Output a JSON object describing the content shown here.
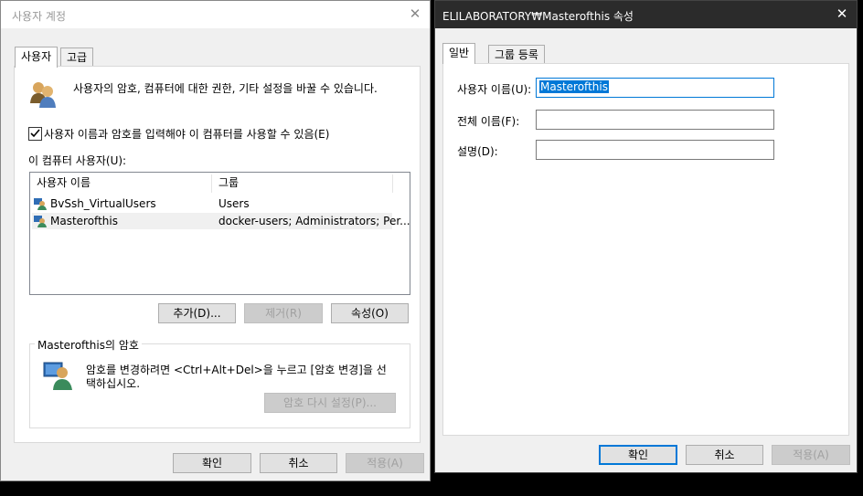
{
  "left_window": {
    "title": "사용자 계정",
    "tabs": [
      "사용자",
      "고급"
    ],
    "intro": "사용자의 암호, 컴퓨터에 대한 권한, 기타 설정을 바꿀 수 있습니다.",
    "require_login_checkbox": {
      "label": "사용자 이름과 암호를 입력해야 이 컴퓨터를 사용할 수 있음(E)",
      "checked": true
    },
    "users_label": "이 컴퓨터 사용자(U):",
    "columns": [
      "사용자 이름",
      "그룹"
    ],
    "users": [
      {
        "name": "BvSsh_VirtualUsers",
        "group": "Users"
      },
      {
        "name": "Masterofthis",
        "group": "docker-users; Administrators; Per..."
      }
    ],
    "buttons": {
      "add": "추가(D)...",
      "remove": "제거(R)",
      "properties": "속성(O)"
    },
    "password_group": {
      "title": "Masterofthis의 암호",
      "text_line1": "암호를 변경하려면 <Ctrl+Alt+Del>을 누르고 [암호 변경]을 선",
      "text_line2": "택하십시오.",
      "reset_button": "암호 다시 설정(P)..."
    },
    "footer": {
      "ok": "확인",
      "cancel": "취소",
      "apply": "적용(A)"
    }
  },
  "right_window": {
    "title": "ELILABORATORY₩Masterofthis 속성",
    "tabs": [
      "일반",
      "그룹 등록"
    ],
    "fields": {
      "username_label": "사용자 이름(U):",
      "username_value": "Masterofthis",
      "fullname_label": "전체 이름(F):",
      "fullname_value": "",
      "description_label": "설명(D):",
      "description_value": ""
    },
    "footer": {
      "ok": "확인",
      "cancel": "취소",
      "apply": "적용(A)"
    }
  }
}
